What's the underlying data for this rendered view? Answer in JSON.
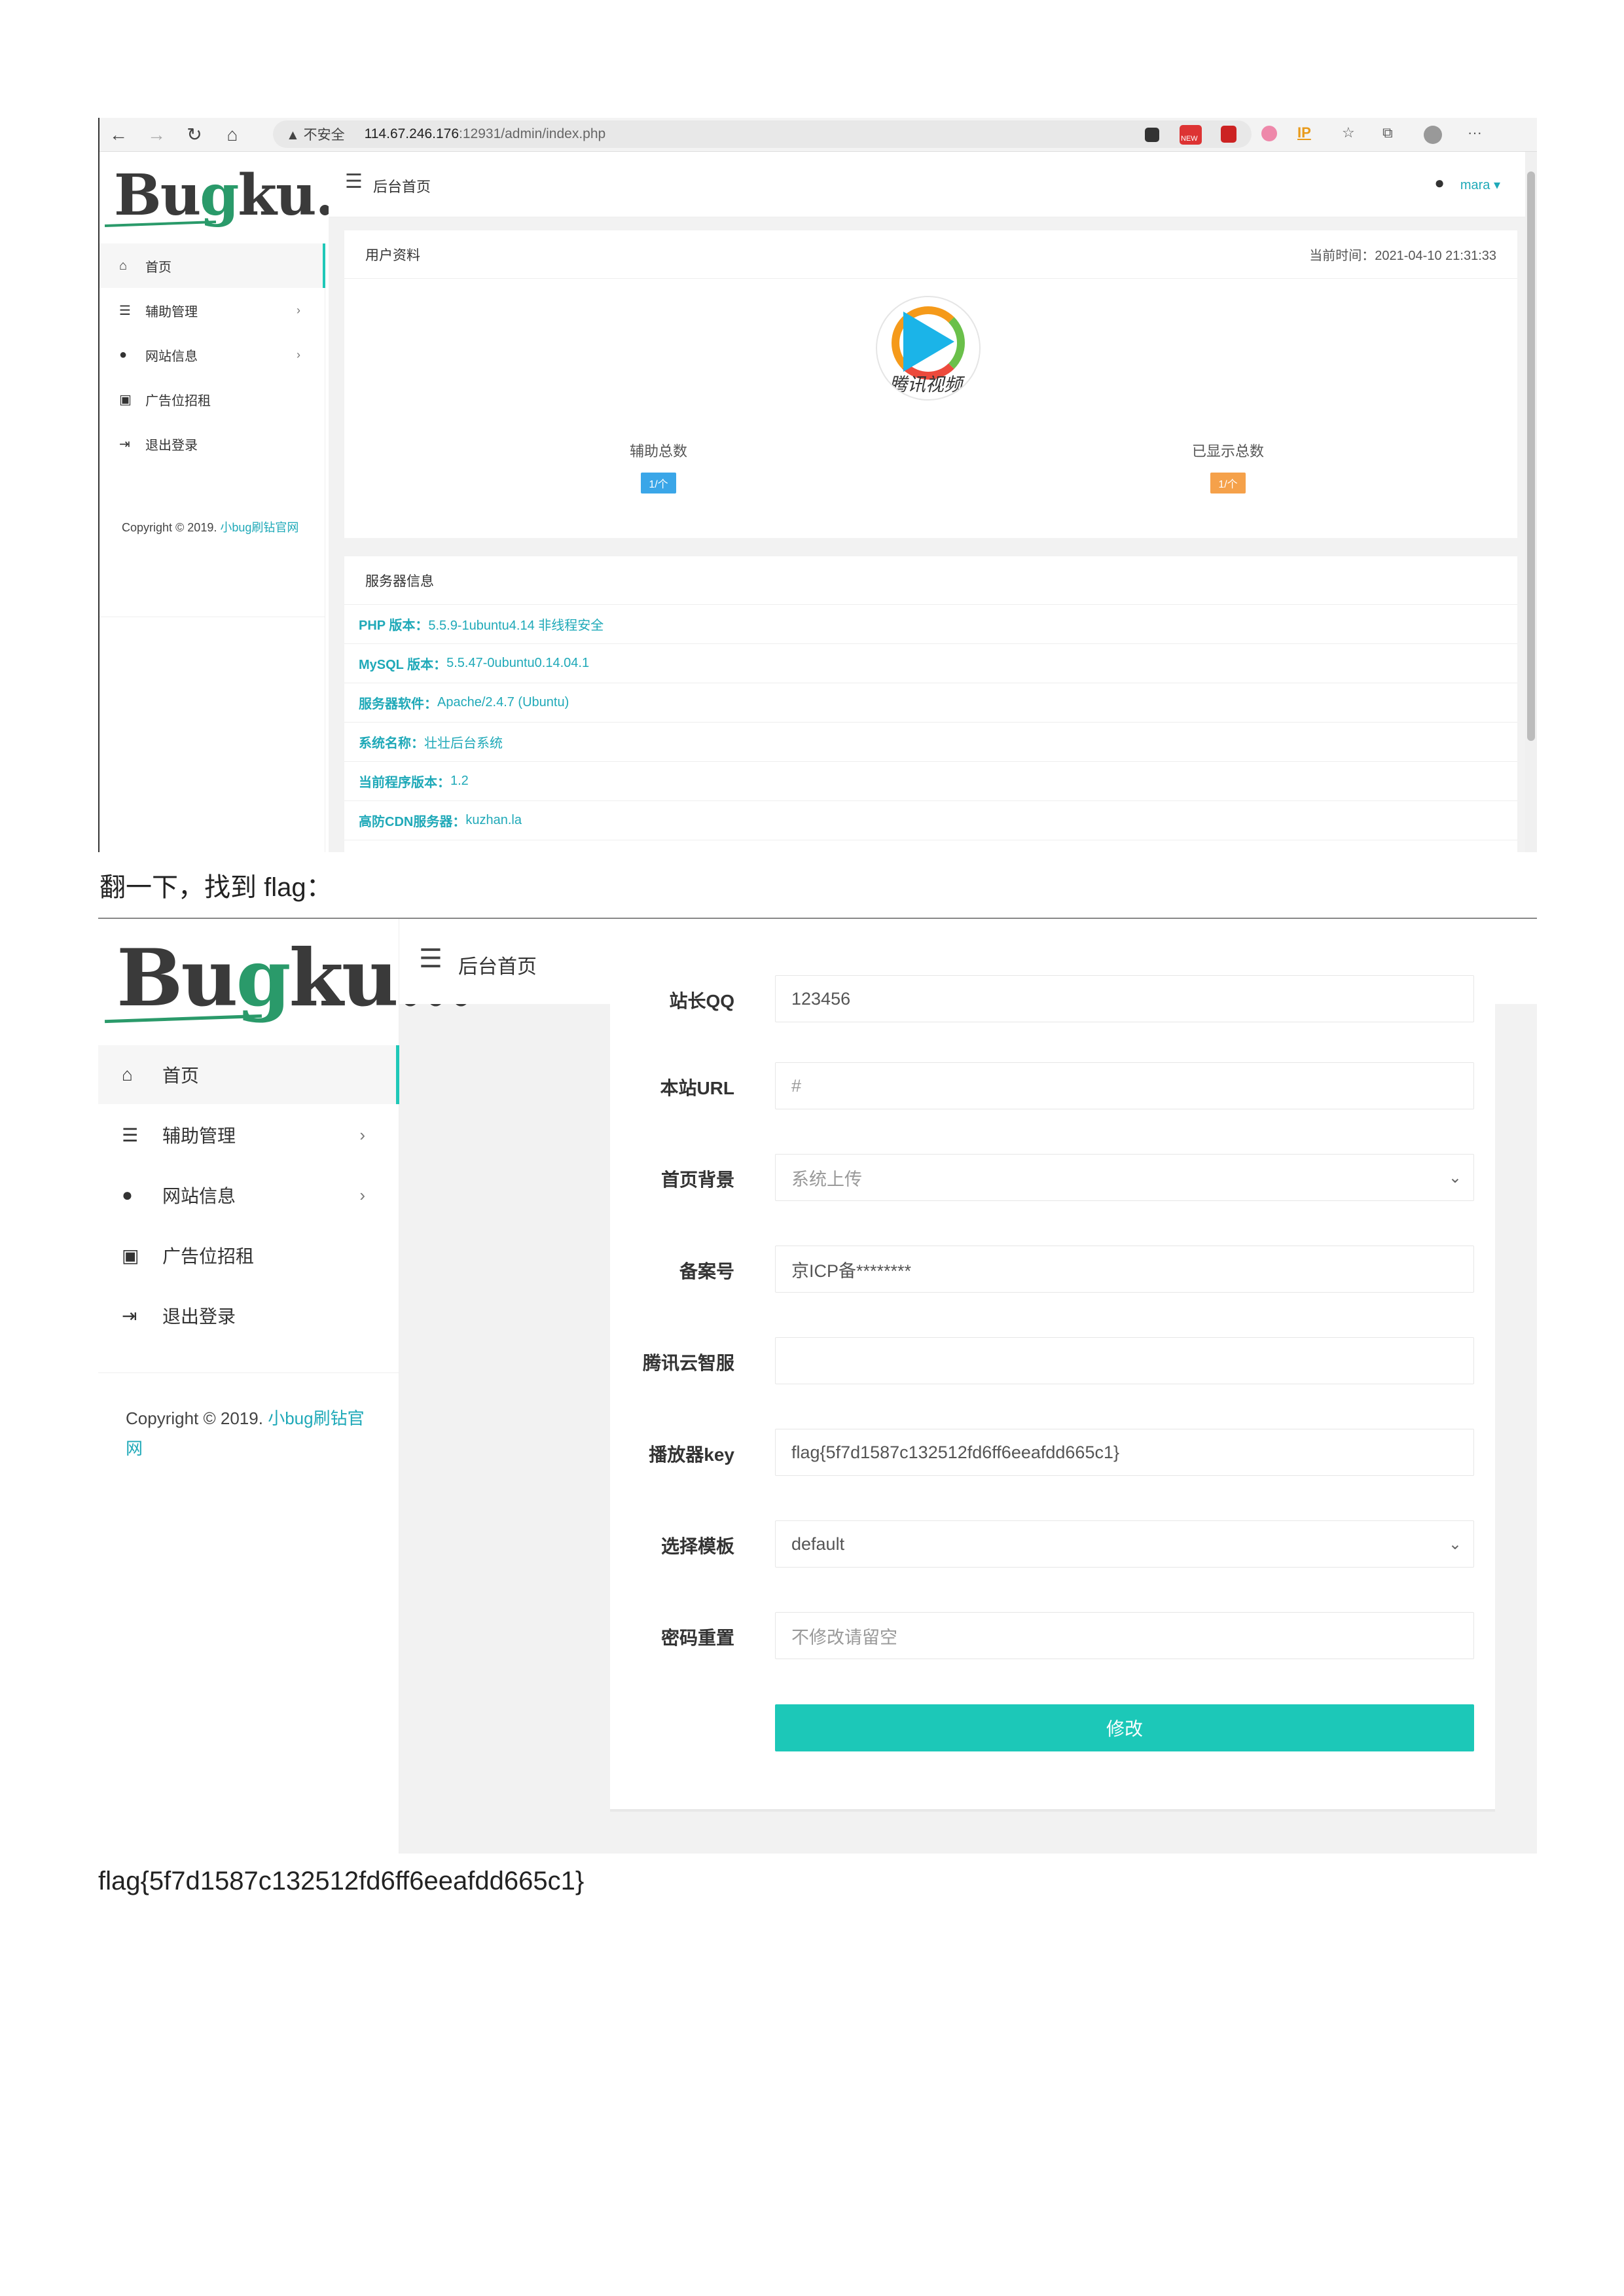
{
  "shot1": {
    "browser": {
      "insecure_label": "不安全",
      "url_host": "114.67.246.176",
      "url_path": ":12931/admin/index.php",
      "ext_new_label": "NEW",
      "ext_ip_label": "IP"
    },
    "logo": {
      "part1": "Bu",
      "part2": "g",
      "part3": "ku..."
    },
    "header": {
      "title": "后台首页",
      "user": "mara ▾"
    },
    "sidebar": {
      "items": [
        {
          "label": "首页",
          "icon": "home-icon"
        },
        {
          "label": "辅助管理",
          "icon": "list-icon"
        },
        {
          "label": "网站信息",
          "icon": "palette-icon"
        },
        {
          "label": "广告位招租",
          "icon": "card-icon"
        },
        {
          "label": "退出登录",
          "icon": "logout-icon"
        }
      ],
      "copyright": "Copyright © 2019.",
      "copyright_link": "小bug刷钻官网"
    },
    "profile_card": {
      "title": "用户资料",
      "time_label": "当前时间：",
      "time_value": "2021-04-10 21:31:33",
      "logo_text": "腾讯视频",
      "stats": [
        {
          "label": "辅助总数",
          "badge": "1/个",
          "color": "#3aa6e8"
        },
        {
          "label": "已显示总数",
          "badge": "1/个",
          "color": "#f5a14a"
        }
      ]
    },
    "server_card": {
      "title": "服务器信息",
      "rows": [
        {
          "key": "PHP 版本：",
          "value": "5.5.9-1ubuntu4.14 非线程安全"
        },
        {
          "key": "MySQL 版本：",
          "value": "5.5.47-0ubuntu0.14.04.1"
        },
        {
          "key": "服务器软件：",
          "value": "Apache/2.4.7 (Ubuntu)"
        },
        {
          "key": "系统名称：",
          "value": "壮壮后台系统"
        },
        {
          "key": "当前程序版本：",
          "value": "1.2"
        },
        {
          "key": "高防CDN服务器：",
          "value": "kuzhan.la"
        }
      ]
    }
  },
  "caption1": "翻一下，找到 flag：",
  "shot2": {
    "header": {
      "title": "后台首页"
    },
    "sidebar": {
      "items": [
        {
          "label": "首页"
        },
        {
          "label": "辅助管理"
        },
        {
          "label": "网站信息"
        },
        {
          "label": "广告位招租"
        },
        {
          "label": "退出登录"
        }
      ],
      "copyright": "Copyright © 2019.",
      "copyright_link": "小bug刷钻官网"
    },
    "form": {
      "rows": [
        {
          "label": "站长QQ",
          "value": "123456"
        },
        {
          "label": "本站URL",
          "value": "#"
        },
        {
          "label": "首页背景",
          "value": "系统上传"
        },
        {
          "label": "备案号",
          "value": "京ICP备********"
        },
        {
          "label": "腾讯云智服",
          "value": ""
        },
        {
          "label": "播放器key",
          "value": "flag{5f7d1587c132512fd6ff6eeafdd665c1}"
        },
        {
          "label": "选择模板",
          "value": "default"
        },
        {
          "label": "密码重置",
          "placeholder": "不修改请留空"
        }
      ],
      "submit_label": "修改"
    }
  },
  "caption2": "flag{5f7d1587c132512fd6ff6eeafdd665c1}",
  "colors": {
    "accent": "#1cc8b8",
    "link": "#1fa9b8",
    "logo_green": "#2a9a6a"
  }
}
